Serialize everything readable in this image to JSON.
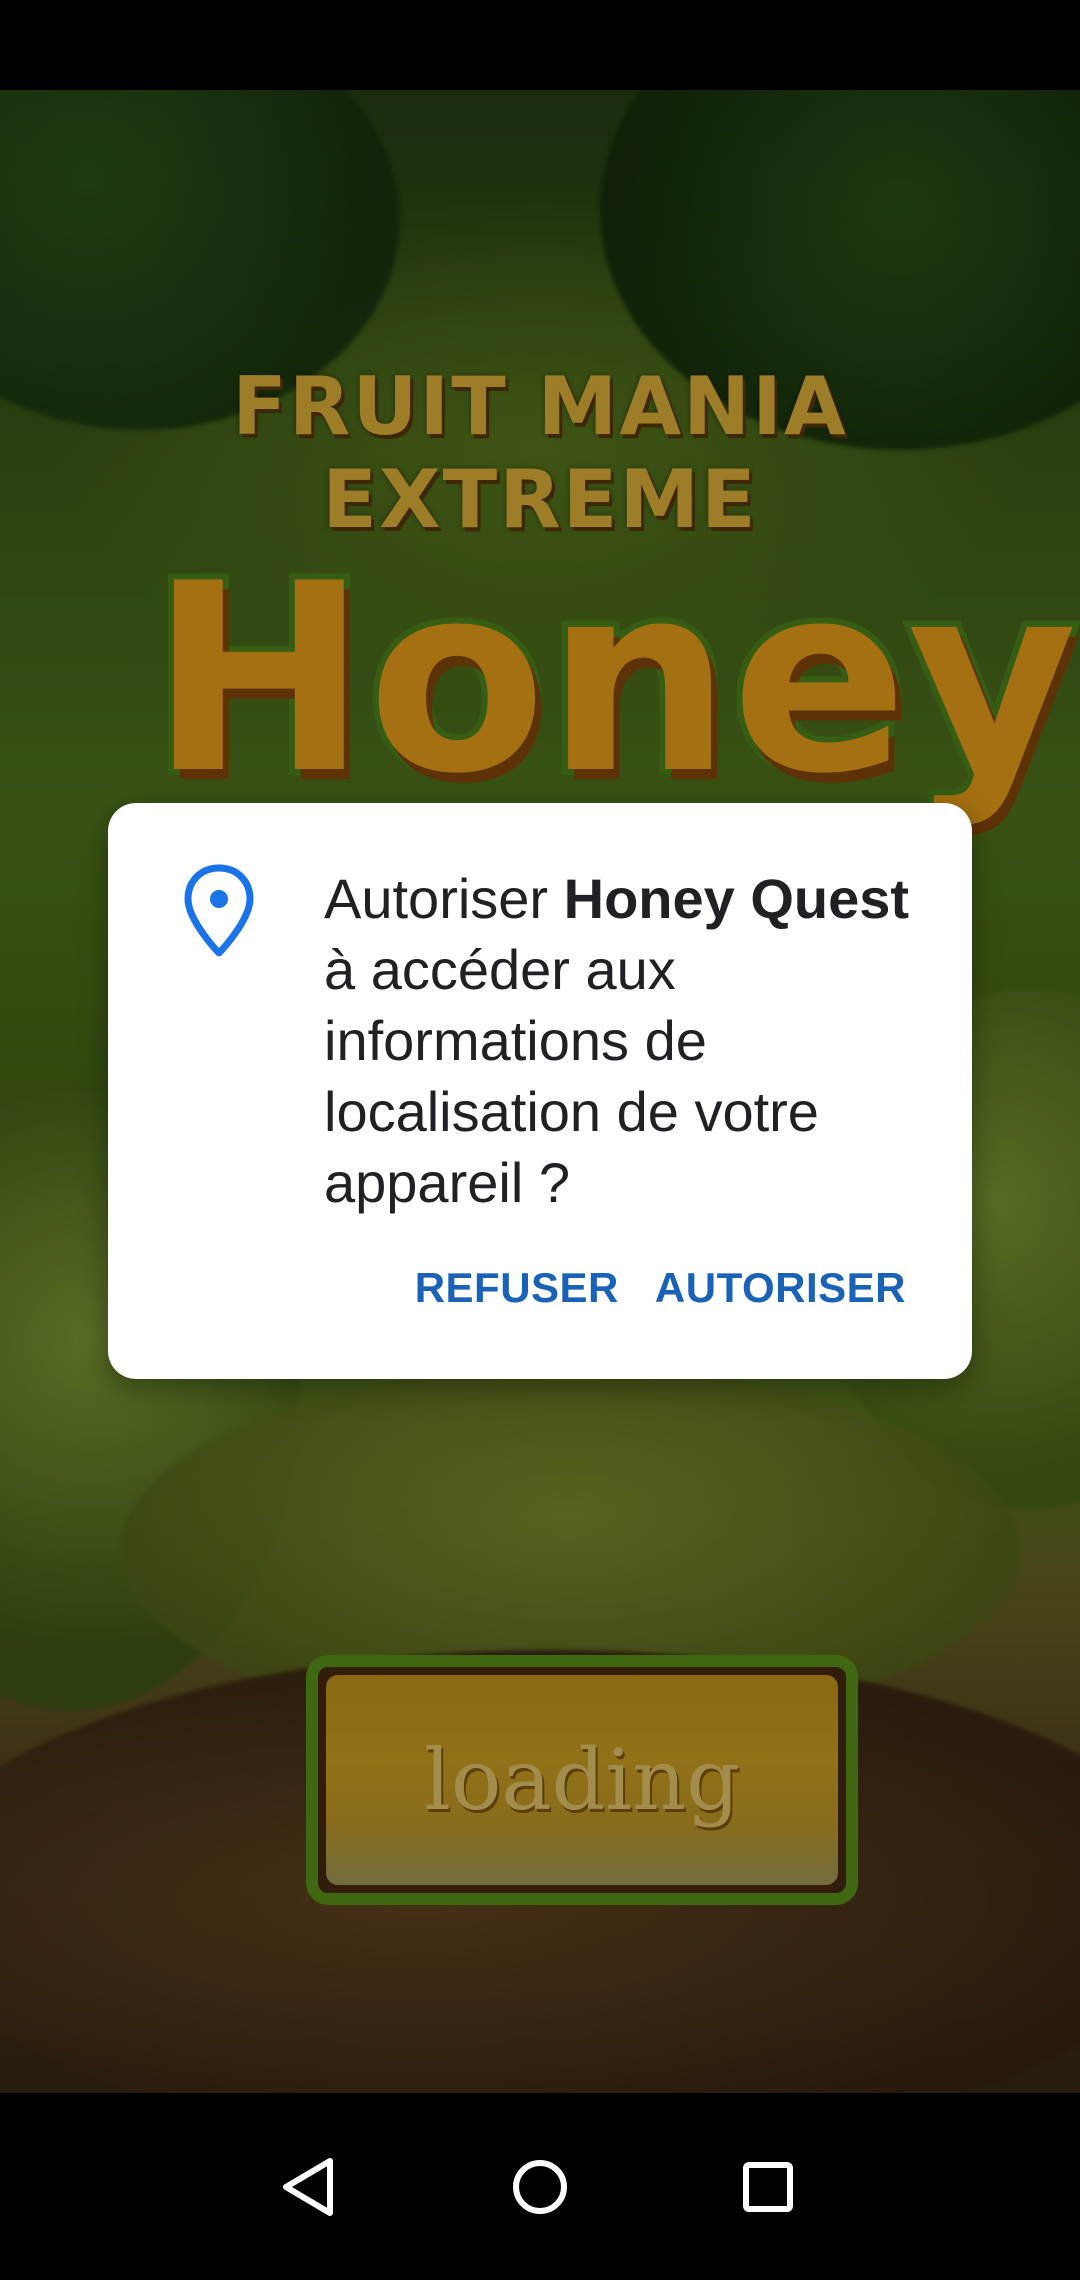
{
  "game": {
    "title": "FRUIT MANIA EXTREME",
    "logo_text": "Honey",
    "loading_label": "loading"
  },
  "dialog": {
    "message_prefix": "Autoriser ",
    "app_name": "Honey Quest",
    "message_suffix": " à accéder aux informations de localisation de votre appareil ?",
    "icon": "location-pin-icon",
    "deny_label": "REFUSER",
    "allow_label": "AUTORISER",
    "accent_color": "#1a73e8"
  },
  "navigation": {
    "back_icon": "back-triangle-icon",
    "home_icon": "home-circle-icon",
    "recents_icon": "recents-square-icon"
  }
}
